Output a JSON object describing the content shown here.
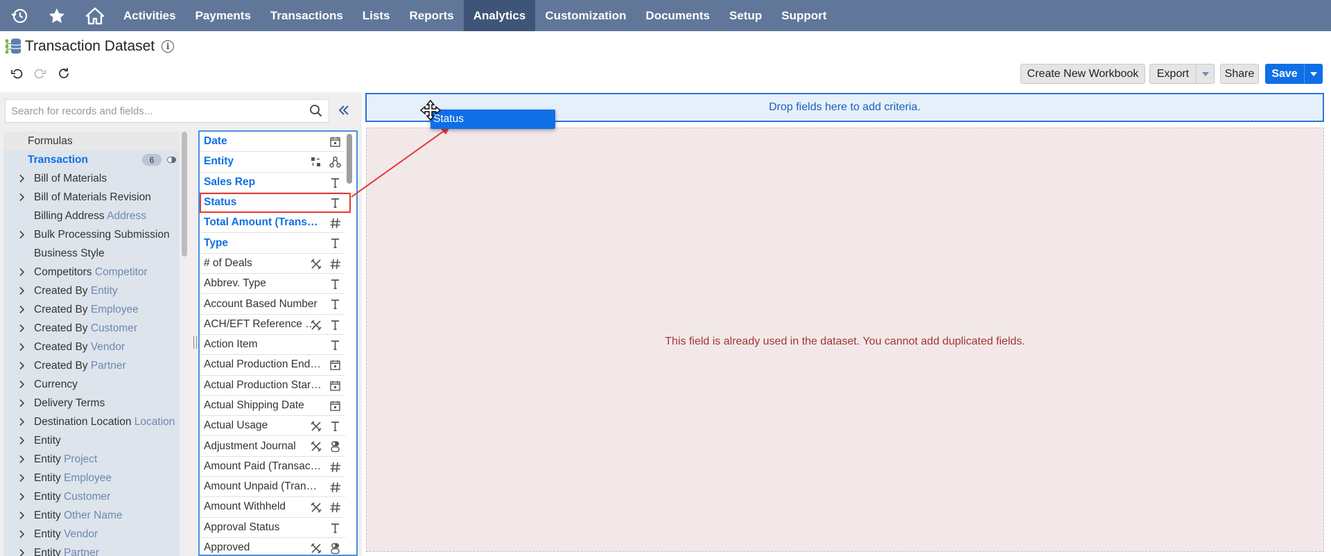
{
  "nav": {
    "items": [
      "Activities",
      "Payments",
      "Transactions",
      "Lists",
      "Reports",
      "Analytics",
      "Customization",
      "Documents",
      "Setup",
      "Support"
    ],
    "active": "Analytics",
    "icons": [
      "recent-history-icon",
      "star-icon",
      "home-icon"
    ]
  },
  "header": {
    "title": "Transaction Dataset",
    "info_glyph": "i"
  },
  "toolbar": {
    "create_workbook": "Create New Workbook",
    "export": "Export",
    "share": "Share",
    "save": "Save"
  },
  "search": {
    "placeholder": "Search for records and fields..."
  },
  "tree": {
    "formulas": "Formulas",
    "transaction": {
      "label": "Transaction",
      "count": "6"
    },
    "items": [
      {
        "label": "Bill of Materials",
        "sub": "",
        "expandable": true
      },
      {
        "label": "Bill of Materials Revision",
        "sub": "",
        "expandable": true
      },
      {
        "label": "Billing Address",
        "sub": "Address",
        "expandable": false
      },
      {
        "label": "Bulk Processing Submission",
        "sub": "",
        "expandable": true
      },
      {
        "label": "Business Style",
        "sub": "",
        "expandable": false
      },
      {
        "label": "Competitors",
        "sub": "Competitor",
        "expandable": true
      },
      {
        "label": "Created By",
        "sub": "Entity",
        "expandable": true
      },
      {
        "label": "Created By",
        "sub": "Employee",
        "expandable": true
      },
      {
        "label": "Created By",
        "sub": "Customer",
        "expandable": true
      },
      {
        "label": "Created By",
        "sub": "Vendor",
        "expandable": true
      },
      {
        "label": "Created By",
        "sub": "Partner",
        "expandable": true
      },
      {
        "label": "Currency",
        "sub": "",
        "expandable": true
      },
      {
        "label": "Delivery Terms",
        "sub": "",
        "expandable": true
      },
      {
        "label": "Destination Location",
        "sub": "Location",
        "expandable": true
      },
      {
        "label": "Entity",
        "sub": "",
        "expandable": true
      },
      {
        "label": "Entity",
        "sub": "Project",
        "expandable": true
      },
      {
        "label": "Entity",
        "sub": "Employee",
        "expandable": true
      },
      {
        "label": "Entity",
        "sub": "Customer",
        "expandable": true
      },
      {
        "label": "Entity",
        "sub": "Other Name",
        "expandable": true
      },
      {
        "label": "Entity",
        "sub": "Vendor",
        "expandable": true
      },
      {
        "label": "Entity",
        "sub": "Partner",
        "expandable": true
      }
    ]
  },
  "fields": [
    {
      "label": "Date",
      "bold": true,
      "icons": [
        "date-icon"
      ]
    },
    {
      "label": "Entity",
      "bold": true,
      "icons": [
        "entity-icon",
        "relationship-icon"
      ]
    },
    {
      "label": "Sales Rep",
      "bold": true,
      "icons": [
        "text-icon"
      ]
    },
    {
      "label": "Status",
      "bold": true,
      "icons": [
        "text-icon"
      ]
    },
    {
      "label": "Total Amount (Transaction Currency)",
      "bold": true,
      "icons": [
        "number-icon"
      ]
    },
    {
      "label": "Type",
      "bold": true,
      "icons": [
        "text-icon"
      ]
    },
    {
      "label": "# of Deals",
      "bold": false,
      "icons": [
        "custom-icon",
        "number-icon"
      ]
    },
    {
      "label": "Abbrev. Type",
      "bold": false,
      "icons": [
        "text-icon"
      ]
    },
    {
      "label": "Account Based Number",
      "bold": false,
      "icons": [
        "text-icon"
      ]
    },
    {
      "label": "ACH/EFT Reference Number",
      "bold": false,
      "icons": [
        "custom-icon",
        "text-icon"
      ]
    },
    {
      "label": "Action Item",
      "bold": false,
      "icons": [
        "text-icon"
      ]
    },
    {
      "label": "Actual Production End Date",
      "bold": false,
      "icons": [
        "date-icon"
      ]
    },
    {
      "label": "Actual Production Start Date",
      "bold": false,
      "icons": [
        "date-icon"
      ]
    },
    {
      "label": "Actual Shipping Date",
      "bold": false,
      "icons": [
        "date-icon"
      ]
    },
    {
      "label": "Actual Usage",
      "bold": false,
      "icons": [
        "custom-icon",
        "text-icon"
      ]
    },
    {
      "label": "Adjustment Journal",
      "bold": false,
      "icons": [
        "custom-icon",
        "boolean-icon"
      ]
    },
    {
      "label": "Amount Paid (Transaction Currency)",
      "bold": false,
      "icons": [
        "number-icon"
      ]
    },
    {
      "label": "Amount Unpaid (Transaction Currency)",
      "bold": false,
      "icons": [
        "number-icon"
      ]
    },
    {
      "label": "Amount Withheld",
      "bold": false,
      "icons": [
        "custom-icon",
        "number-icon"
      ]
    },
    {
      "label": "Approval Status",
      "bold": false,
      "icons": [
        "text-icon"
      ]
    },
    {
      "label": "Approved",
      "bold": false,
      "icons": [
        "custom-icon",
        "boolean-icon"
      ]
    }
  ],
  "criteria": {
    "drop_text": "Drop fields here to add criteria."
  },
  "canvas": {
    "message": "This field is already used in the dataset. You cannot add duplicated fields."
  },
  "drag": {
    "label": "Status"
  },
  "colors": {
    "nav_bg": "#607799",
    "nav_active": "#3f5577",
    "accent": "#0f6fe6",
    "error_text": "#a03535",
    "canvas_bg": "#f3e8e9"
  }
}
